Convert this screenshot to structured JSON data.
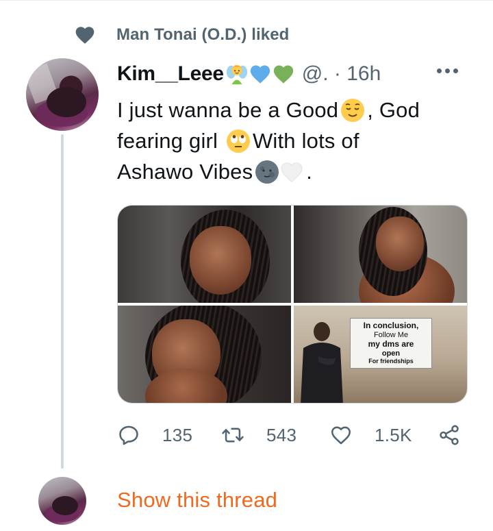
{
  "social_context": {
    "text": "Man Tonai (O.D.) liked",
    "icon": "heart-icon"
  },
  "tweet": {
    "display_name": "Kim__Leee",
    "name_emojis": [
      "fairy-emoji",
      "blue-heart-emoji",
      "green-heart-emoji"
    ],
    "handle": "@.",
    "separator": "·",
    "time": "16h",
    "text_lines": [
      {
        "before": "I just wanna be a Good",
        "emoji": "relieved-face-emoji",
        "after": ", God"
      },
      {
        "before": "fearing girl ",
        "emoji": "rolling-eyes-emoji",
        "after": "With lots of"
      },
      {
        "before": "Ashawo Vibes",
        "emoji": "new-moon-face-emoji",
        "emoji2": "white-heart-emoji",
        "after": "."
      }
    ],
    "media": {
      "meme_text": {
        "line1": "In conclusion,",
        "line2": "Follow Me",
        "line3": "my dms are",
        "line4": "open",
        "line5": "For friendships"
      }
    },
    "actions": {
      "replies": "135",
      "retweets": "543",
      "likes": "1.5K"
    }
  },
  "thread_link": {
    "label": "Show this thread",
    "color": "#ef6a1f"
  },
  "colors": {
    "secondary_text": "#536471",
    "divider": "#cfd9de",
    "accent": "#ef6a1f"
  }
}
